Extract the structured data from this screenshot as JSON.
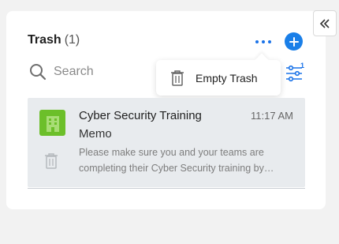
{
  "panel": {
    "title": "Trash",
    "count": "(1)"
  },
  "header": {
    "more_icon": "ellipsis-horizontal-icon",
    "add_icon": "plus-circle-icon",
    "collapse_icon": "double-chevron-left-icon"
  },
  "search": {
    "placeholder": "Search",
    "icon": "search-icon"
  },
  "filter": {
    "icon": "filter-sliders-icon",
    "badge": "1"
  },
  "menu": {
    "items": [
      {
        "label": "Empty Trash",
        "icon": "trash-icon"
      }
    ]
  },
  "messages": [
    {
      "title": "Cyber Security Training",
      "time": "11:17 AM",
      "subtitle": "Memo",
      "preview": "Please make sure you and your teams are completing their Cyber Security training by…",
      "avatar_icon": "building-icon",
      "action_icon": "trash-icon"
    }
  ],
  "colors": {
    "accent": "#1a73e8",
    "avatar": "#6cbf2a",
    "card_bg": "#e8ebee"
  }
}
